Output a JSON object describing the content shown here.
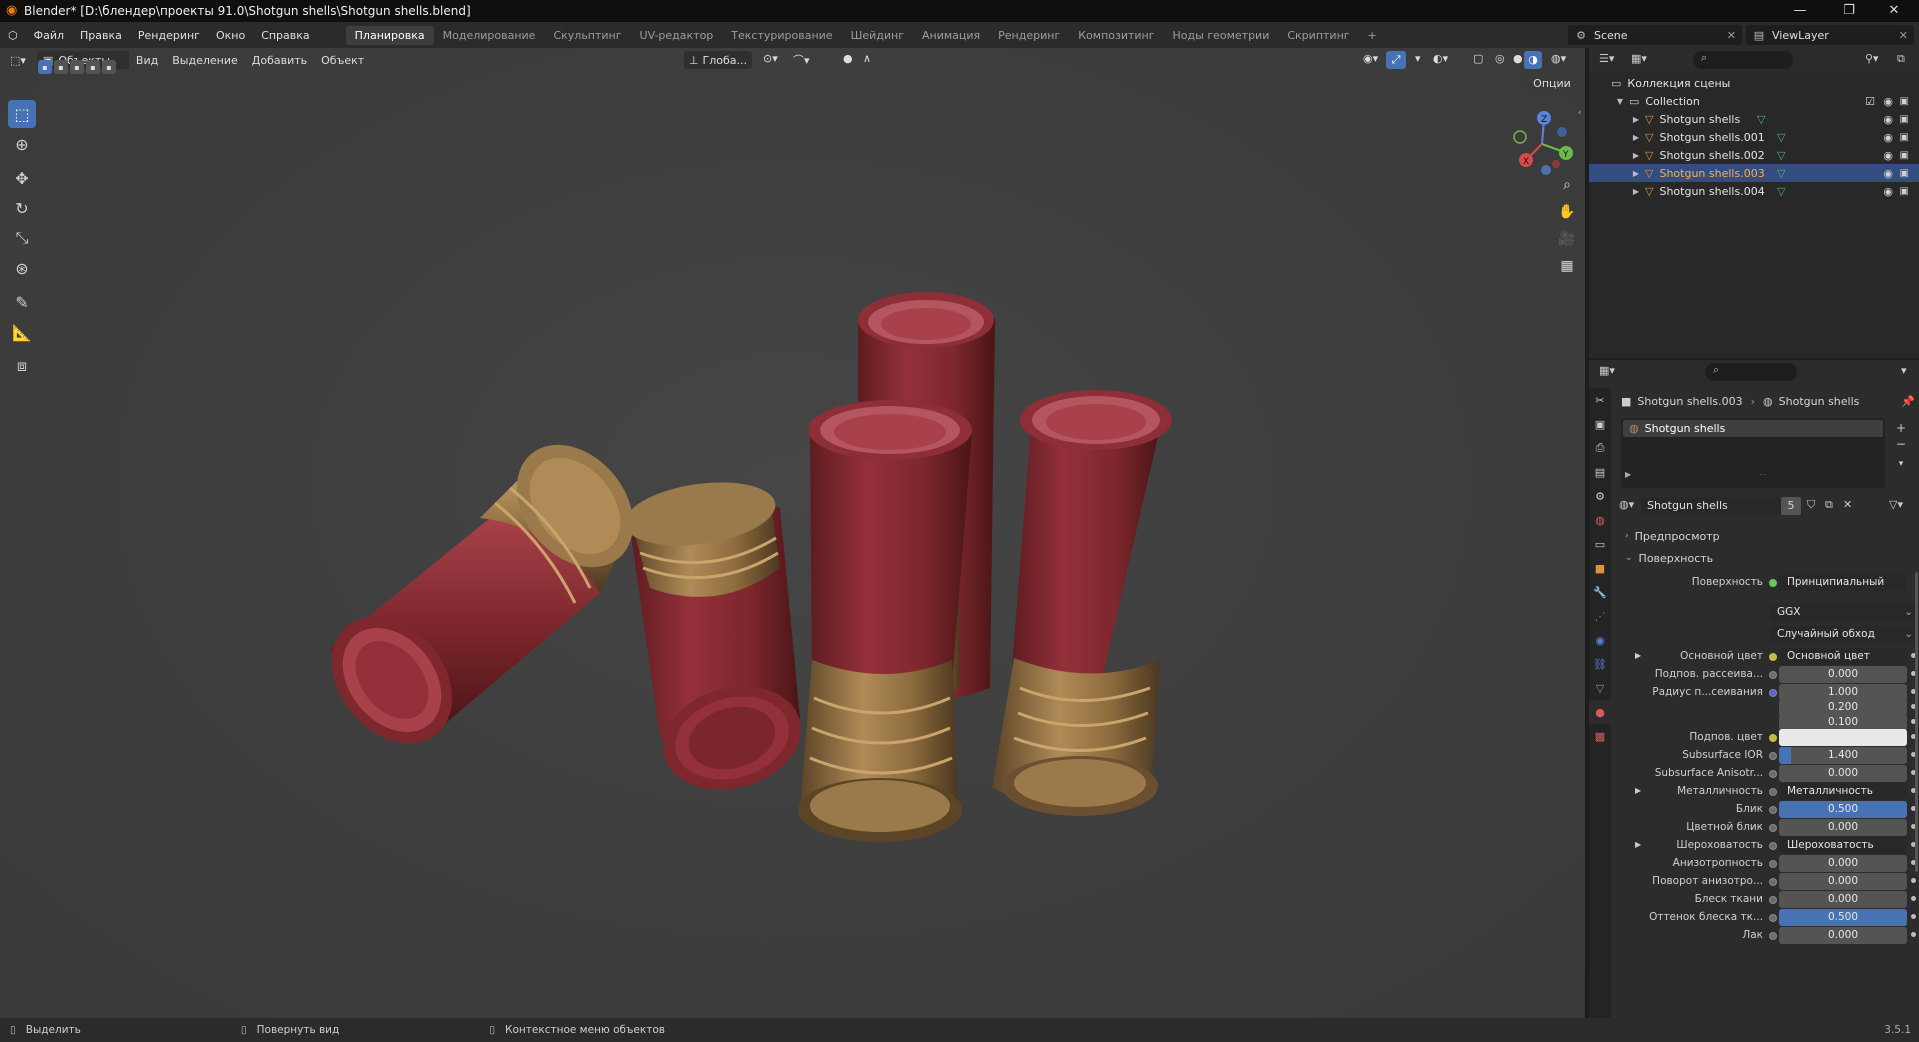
{
  "title": "Blender* [D:\\блендер\\проекты 91.0\\Shotgun shells\\Shotgun shells.blend]",
  "menu": [
    "Файл",
    "Правка",
    "Рендеринг",
    "Окно",
    "Справка"
  ],
  "workspaces": [
    "Планировка",
    "Моделирование",
    "Скульптинг",
    "UV-редактор",
    "Текстурирование",
    "Шейдинг",
    "Анимация",
    "Рендеринг",
    "Композитинг",
    "Ноды геометрии",
    "Скриптинг"
  ],
  "active_workspace": "Планировка",
  "scene": "Scene",
  "view_layer": "ViewLayer",
  "viewport": {
    "mode": "Объекты",
    "menus": [
      "Вид",
      "Выделение",
      "Добавить",
      "Объект"
    ],
    "transform": "Глоба...",
    "options": "Опции",
    "gizmo": {
      "x": "X",
      "y": "Y",
      "z": "Z"
    },
    "shell_color": "#8a2b2e",
    "brass_color": "#a07a45"
  },
  "outliner": {
    "root": "Коллекция сцены",
    "collection": "Collection",
    "items": [
      "Shotgun shells",
      "Shotgun shells.001",
      "Shotgun shells.002",
      "Shotgun shells.003",
      "Shotgun shells.004"
    ],
    "selected_index": 3
  },
  "properties": {
    "object": "Shotgun shells.003",
    "material": "Shotgun shells",
    "slot": "Shotgun shells",
    "material_field": "Shotgun shells",
    "users": "5",
    "panels": {
      "preview": "Предпросмотр",
      "surface": "Поверхность"
    },
    "surface_label": "Поверхность",
    "surface_value": "Принципиальный BSDF",
    "distribution": "GGX",
    "subsurface_method": "Случайный обход",
    "rows": [
      {
        "label": "Основной цвет",
        "value": "Основной цвет",
        "dot": "y",
        "style": "dark",
        "exp": true
      },
      {
        "label": "Подпов. рассеива...",
        "value": "0.000",
        "dot": "n",
        "style": ""
      },
      {
        "label": "Радиус п...сеивания",
        "value": "1.000",
        "dot": "p",
        "style": ""
      },
      {
        "label": "",
        "value": "0.200",
        "dot": "none",
        "style": ""
      },
      {
        "label": "",
        "value": "0.100",
        "dot": "none",
        "style": ""
      },
      {
        "label": "Подпов. цвет",
        "value": "",
        "dot": "y",
        "style": "white"
      },
      {
        "label": "Subsurface IOR",
        "value": "1.400",
        "dot": "n",
        "style": "ior"
      },
      {
        "label": "Subsurface Anisotr...",
        "value": "0.000",
        "dot": "n",
        "style": ""
      },
      {
        "label": "Металличность",
        "value": "Металличность",
        "dot": "n",
        "style": "dark",
        "exp": true
      },
      {
        "label": "Блик",
        "value": "0.500",
        "dot": "n",
        "style": "blue"
      },
      {
        "label": "Цветной блик",
        "value": "0.000",
        "dot": "n",
        "style": ""
      },
      {
        "label": "Шероховатость",
        "value": "Шероховатость",
        "dot": "n",
        "style": "dark",
        "exp": true
      },
      {
        "label": "Анизотропность",
        "value": "0.000",
        "dot": "n",
        "style": ""
      },
      {
        "label": "Поворот анизотро...",
        "value": "0.000",
        "dot": "n",
        "style": ""
      },
      {
        "label": "Блеск ткани",
        "value": "0.000",
        "dot": "n",
        "style": ""
      },
      {
        "label": "Оттенок блеска тк...",
        "value": "0.500",
        "dot": "n",
        "style": "blue"
      },
      {
        "label": "Лак",
        "value": "0.000",
        "dot": "n",
        "style": ""
      }
    ]
  },
  "status": {
    "select": "Выделить",
    "rotate": "Повернуть вид",
    "context": "Контекстное меню объектов",
    "version": "3.5.1"
  }
}
